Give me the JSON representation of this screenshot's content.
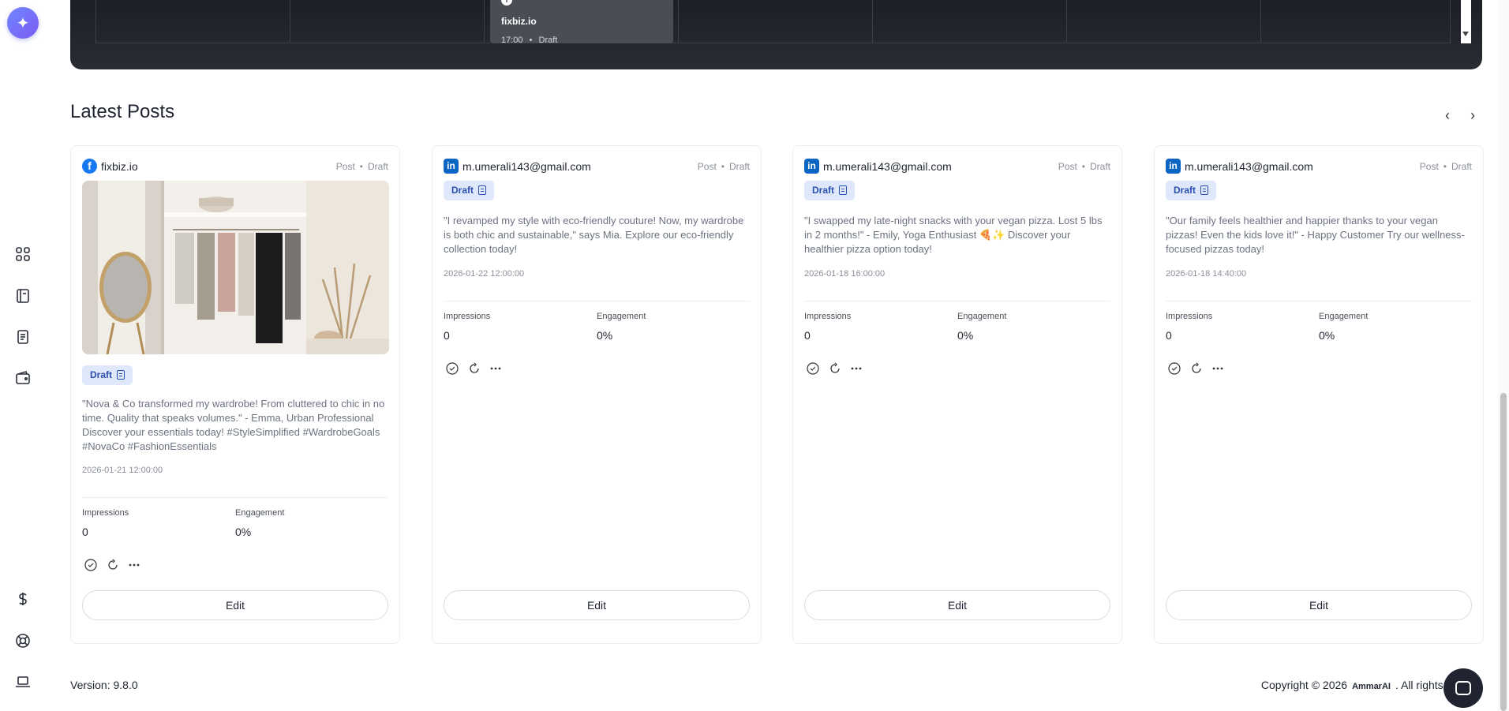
{
  "calendar": {
    "event": {
      "account": "fixbiz.io",
      "time": "17:00",
      "sep": "•",
      "status": "Draft"
    }
  },
  "section": {
    "title": "Latest Posts"
  },
  "nav": {
    "prev": "‹",
    "next": "›"
  },
  "labels": {
    "impressions": "Impressions",
    "engagement": "Engagement",
    "edit": "Edit",
    "draft_badge": "Draft",
    "post_type": "Post",
    "dot": "•"
  },
  "posts": [
    {
      "network": "facebook",
      "account": "fixbiz.io",
      "type": "Post",
      "status": "Draft",
      "badge": "Draft",
      "text": "\"Nova & Co transformed my wardrobe! From cluttered to chic in no time. Quality that speaks volumes.\" - Emma, Urban Professional Discover your essentials today! #StyleSimplified #WardrobeGoals #NovaCo #FashionEssentials",
      "date": "2026-01-21 12:00:00",
      "impressions": "0",
      "engagement": "0%",
      "has_image": true
    },
    {
      "network": "linkedin",
      "account": "m.umerali143@gmail.com",
      "type": "Post",
      "status": "Draft",
      "badge": "Draft",
      "text": "\"I revamped my style with eco-friendly couture! Now, my wardrobe is both chic and sustainable,\" says Mia. Explore our eco-friendly collection today!",
      "date": "2026-01-22 12:00:00",
      "impressions": "0",
      "engagement": "0%",
      "has_image": false
    },
    {
      "network": "linkedin",
      "account": "m.umerali143@gmail.com",
      "type": "Post",
      "status": "Draft",
      "badge": "Draft",
      "text": "\"I swapped my late-night snacks with your vegan pizza. Lost 5 lbs in 2 months!\" - Emily, Yoga Enthusiast 🍕✨ Discover your healthier pizza option today!",
      "date": "2026-01-18 16:00:00",
      "impressions": "0",
      "engagement": "0%",
      "has_image": false
    },
    {
      "network": "linkedin",
      "account": "m.umerali143@gmail.com",
      "type": "Post",
      "status": "Draft",
      "badge": "Draft",
      "text": "\"Our family feels healthier and happier thanks to your vegan pizzas! Even the kids love it!\" - Happy Customer Try our wellness-focused pizzas today!",
      "date": "2026-01-18 14:40:00",
      "impressions": "0",
      "engagement": "0%",
      "has_image": false
    }
  ],
  "footer": {
    "version": "Version: 9.8.0",
    "copyright_prefix": "Copyright © 2026",
    "brand": "AmmarAI",
    "copyright_suffix": ". All rights res"
  },
  "sidebar_icons": [
    "dashboard-icon",
    "book-icon",
    "document-icon",
    "wallet-icon",
    "dollar-icon",
    "lifebuoy-icon",
    "laptop-icon"
  ],
  "colors": {
    "accent": "#6f86ff",
    "facebook": "#1877f2",
    "linkedin": "#0a66c2",
    "badge_bg": "#dfe7fb",
    "badge_text": "#2a4fae"
  }
}
